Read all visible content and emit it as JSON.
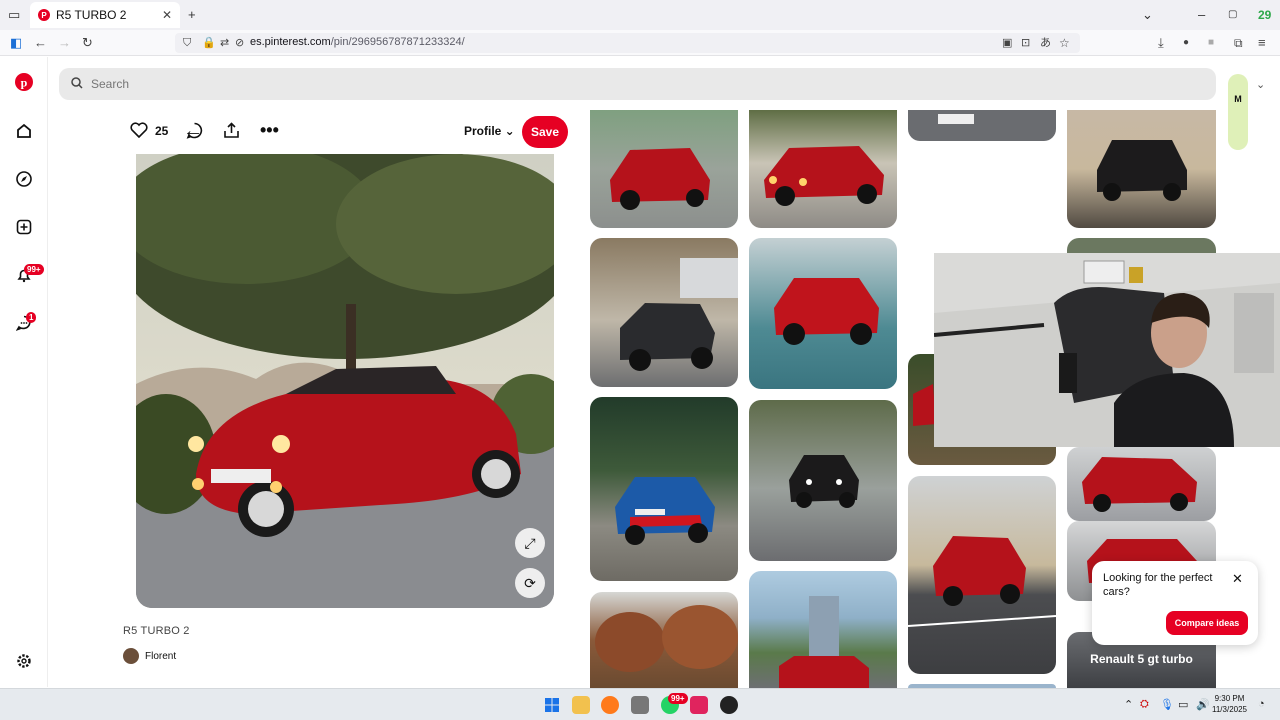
{
  "browser": {
    "tab_title": "R5 TURBO 2",
    "url_domain": "es.pinterest.com",
    "url_path": "/pin/296956787871233324/",
    "extension_badge": "29",
    "new_tab_symbol": "+"
  },
  "sidebar": {
    "items": [
      {
        "name": "home-icon",
        "glyph": "⌂"
      },
      {
        "name": "explore-icon",
        "glyph": "◎"
      },
      {
        "name": "create-icon",
        "glyph": "⊞"
      },
      {
        "name": "notifications-icon",
        "glyph": "🔔",
        "badge": "99+"
      },
      {
        "name": "messages-icon",
        "glyph": "💬",
        "badge": "1"
      },
      {
        "name": "settings-icon",
        "glyph": "⚙"
      }
    ]
  },
  "search": {
    "placeholder": "Search"
  },
  "account": {
    "initial": "M"
  },
  "pin": {
    "likes": "25",
    "profile_label": "Profile",
    "save_label": "Save",
    "title": "R5 TURBO 2",
    "author": "Florent"
  },
  "grid": {
    "overlay_label": "Renault 5 gt turbo"
  },
  "popup": {
    "text": "Looking for the perfect cars?",
    "button": "Compare ideas"
  },
  "taskbar": {
    "time": "9:30 PM",
    "date": "11/3/2025",
    "whatsapp_badge": "99+"
  },
  "colors": {
    "brand": "#e60023",
    "search_bg": "#e9e9e9",
    "avatar_bg": "#dff0b8"
  }
}
